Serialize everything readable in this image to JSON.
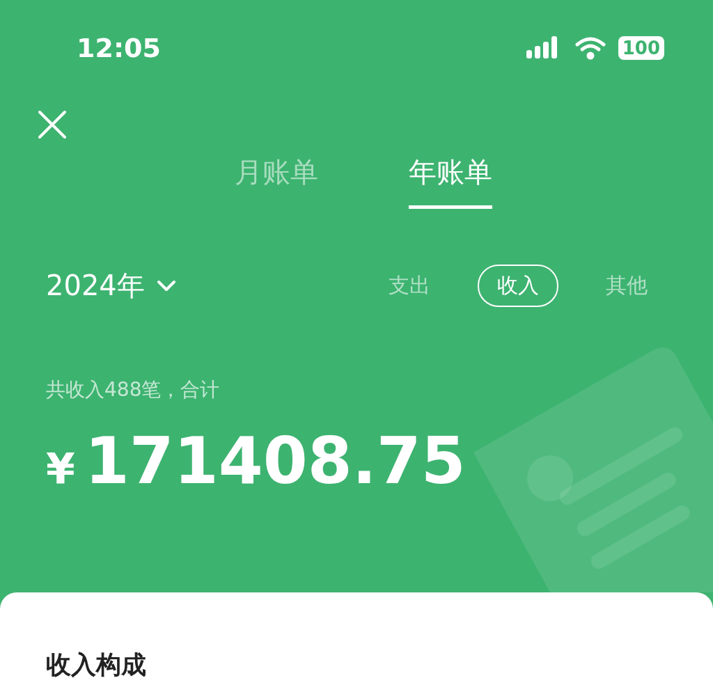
{
  "status_bar": {
    "time": "12:05",
    "battery": "100"
  },
  "tabs": [
    {
      "label": "月账单",
      "selected": false
    },
    {
      "label": "年账单",
      "selected": true
    }
  ],
  "year_picker": {
    "label": "2024年"
  },
  "filters": [
    {
      "label": "支出",
      "selected": false
    },
    {
      "label": "收入",
      "selected": true
    },
    {
      "label": "其他",
      "selected": false
    }
  ],
  "summary": {
    "caption": "共收入488笔，合计",
    "currency": "¥",
    "amount": "171408.75"
  },
  "section": {
    "title": "收入构成"
  }
}
